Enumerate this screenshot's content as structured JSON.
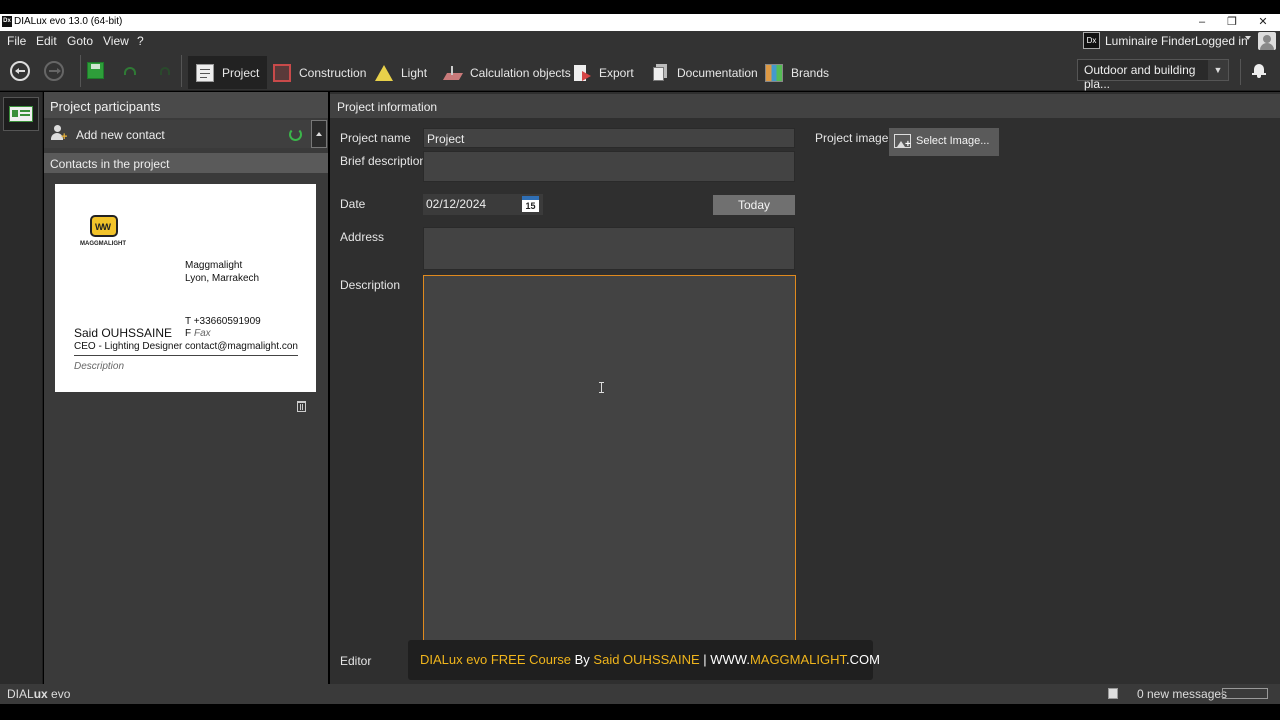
{
  "window": {
    "title": "DIALux evo 13.0  (64-bit)",
    "logo": "Dx",
    "controls": {
      "minimize": "–",
      "restore": "❐",
      "close": "✕"
    }
  },
  "menu": {
    "items": [
      "File",
      "Edit",
      "Goto",
      "View",
      "?"
    ]
  },
  "header_right": {
    "luminaire_finder": "Luminaire Finder",
    "logged_in": "Logged in",
    "logo": "Dx"
  },
  "toolbar": {
    "tabs": [
      {
        "label": "Project",
        "icon": "project-icon"
      },
      {
        "label": "Construction",
        "icon": "construction-icon"
      },
      {
        "label": "Light",
        "icon": "light-icon"
      },
      {
        "label": "Calculation objects",
        "icon": "calculation-icon"
      },
      {
        "label": "Export",
        "icon": "export-icon"
      },
      {
        "label": "Documentation",
        "icon": "documentation-icon"
      },
      {
        "label": "Brands",
        "icon": "brands-icon"
      }
    ],
    "dropdown_value": "Outdoor and building pla..."
  },
  "participants": {
    "title": "Project participants",
    "add_contact": "Add new contact",
    "contacts_header": "Contacts in the project",
    "card": {
      "logo_text": "MAGGMALIGHT",
      "company": "Maggmalight",
      "location": "Lyon, Marrakech",
      "phone": "T +33660591909",
      "fax_prefix": "F",
      "fax": "Fax",
      "name": "Said OUHSSAINE",
      "role": "CEO - Lighting Designer",
      "email": "contact@magmalight.con",
      "description": "Description"
    }
  },
  "project_info": {
    "title": "Project information",
    "labels": {
      "name": "Project name",
      "brief": "Brief description",
      "date": "Date",
      "address": "Address",
      "description": "Description",
      "editor": "Editor",
      "image": "Project image"
    },
    "values": {
      "name": "Project",
      "date": "02/12/2024",
      "calendar_day": "15"
    },
    "buttons": {
      "today": "Today",
      "select_image": "Select Image..."
    }
  },
  "watermark": {
    "part1": "DIALux evo FREE Course",
    "by": " By ",
    "author": "Said OUHSSAINE",
    "sep": " | WWW.",
    "site": "MAGGMALIGHT",
    "tld": ".COM"
  },
  "status": {
    "app_prefix": "DIAL",
    "app_bold": "ux",
    "app_suffix": " evo",
    "messages": "0 new messages"
  },
  "colors": {
    "accent_orange": "#e08a1e",
    "gold": "#f0b51c"
  }
}
